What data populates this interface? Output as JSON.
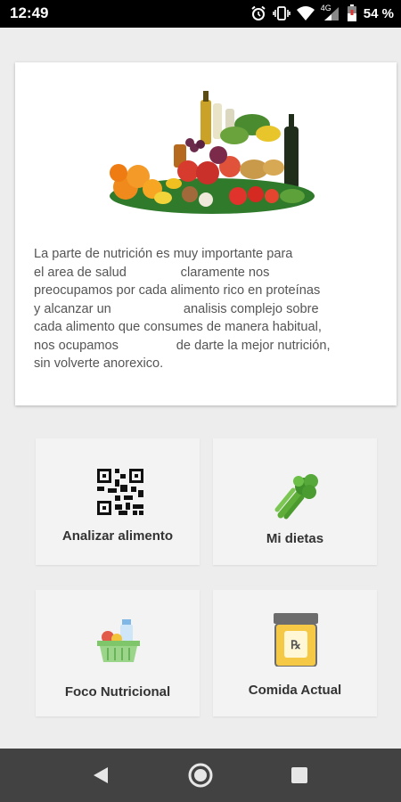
{
  "status_bar": {
    "time": "12:49",
    "network": "4G",
    "battery": "54 %",
    "icons": [
      "alarm-icon",
      "vibrate-icon",
      "wifi-icon",
      "signal-icon",
      "battery-icon"
    ]
  },
  "info": {
    "image": "fruits-vegetables-wine-image",
    "text": "La parte de nutrición es muy importante para\nel area de salud               claramente nos\npreocupamos por cada alimento rico en proteínas\ny alcanzar un                    analisis complejo sobre\ncada alimento que consumes de manera habitual,\nnos ocupamos                de darte la mejor nutrición,\nsin volverte anorexico."
  },
  "menu": {
    "items": [
      {
        "label": "Analizar alimento",
        "icon": "qr-code-icon"
      },
      {
        "label": "Mi dietas",
        "icon": "celery-icon"
      },
      {
        "label": "Foco Nutricional",
        "icon": "grocery-basket-icon"
      },
      {
        "label": "Comida Actual",
        "icon": "prescription-jar-icon"
      }
    ]
  },
  "nav": {
    "buttons": [
      "back-icon",
      "home-icon",
      "recents-icon"
    ]
  },
  "colors": {
    "background": "#ededed",
    "card": "#ffffff",
    "tile": "#f3f3f3",
    "nav_bar": "#424242",
    "status_bar": "#000000"
  }
}
